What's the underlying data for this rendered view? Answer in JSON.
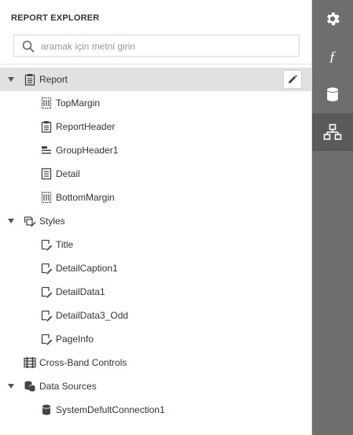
{
  "panel": {
    "title": "REPORT EXPLORER"
  },
  "search": {
    "placeholder": "aramak için metni girin",
    "value": ""
  },
  "tree": {
    "report": "Report",
    "top_margin": "TopMargin",
    "report_header": "ReportHeader",
    "group_header": "GroupHeader1",
    "detail": "Detail",
    "bottom_margin": "BottomMargin",
    "styles": "Styles",
    "style_title": "Title",
    "style_detail_caption": "DetailCaption1",
    "style_detail_data": "DetailData1",
    "style_detail_data_odd": "DetailData3_Odd",
    "style_page_info": "PageInfo",
    "cross_band": "Cross-Band Controls",
    "data_sources": "Data Sources",
    "connection": "SystemDefultConnection1"
  },
  "sidebar": {
    "buttons": [
      "gear-icon",
      "function-icon",
      "database-icon",
      "report-explorer-icon"
    ],
    "active": "report-explorer-icon"
  },
  "colors": {
    "sidebar_bg": "#6e6e6e",
    "sidebar_active": "#5a5a5a",
    "selected_row": "#e1e1e1"
  }
}
